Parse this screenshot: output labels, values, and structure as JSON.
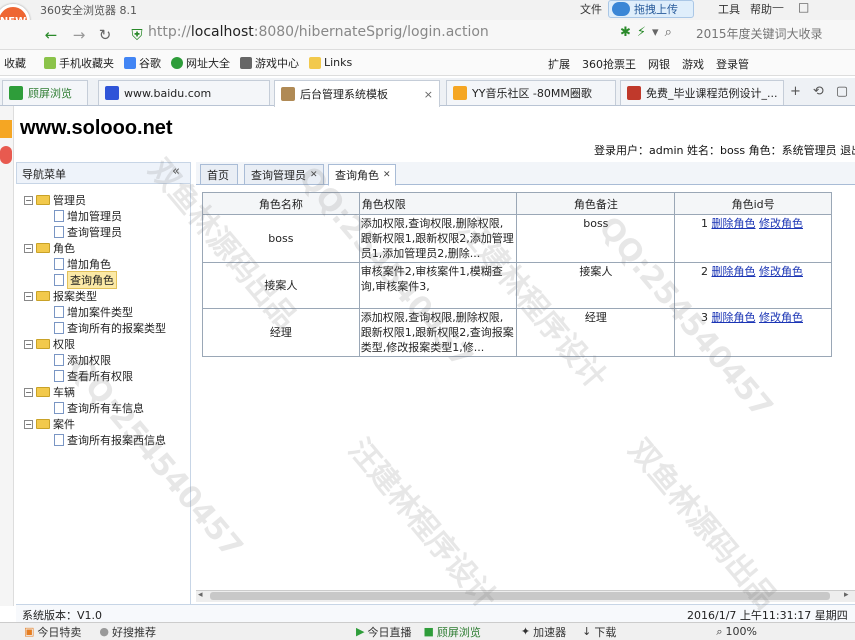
{
  "browser": {
    "logo_text": "NEW",
    "title": "360安全浏览器 8.1",
    "menus": [
      "文件",
      "工具",
      "帮助"
    ],
    "cloud_upload": "拖拽上传",
    "address_prefix": "http://",
    "address_host": "localhost",
    "address_rest": ":8080/hibernateSprig/login.action",
    "search_placeholder": "2015年度关键词大收录"
  },
  "bookmarks": {
    "items": [
      "收藏",
      "手机收藏夹",
      "谷歌",
      "网址大全",
      "游戏中心",
      "Links"
    ],
    "right": [
      "扩展",
      "360抢票王",
      "网银",
      "游戏",
      "登录管"
    ]
  },
  "tabs": [
    {
      "label": "顾屏浏览"
    },
    {
      "label": "www.baidu.com"
    },
    {
      "label": "后台管理系统模板"
    },
    {
      "label": "YY音乐社区 -80MM圈歌"
    },
    {
      "label": "免费_毕业课程范例设计_..."
    }
  ],
  "page": {
    "site_title": "www.solooo.net",
    "user_info": "登录用户：admin  姓名：boss  角色：系统管理员  退出"
  },
  "nav": {
    "header": "导航菜单",
    "collapse": "«",
    "groups": [
      {
        "label": "管理员",
        "items": [
          "增加管理员",
          "查询管理员"
        ]
      },
      {
        "label": "角色",
        "items": [
          "增加角色",
          "查询角色"
        ]
      },
      {
        "label": "报案类型",
        "items": [
          "增加案件类型",
          "查询所有的报案类型"
        ]
      },
      {
        "label": "权限",
        "items": [
          "添加权限",
          "查看所有权限"
        ]
      },
      {
        "label": "车辆",
        "items": [
          "查询所有车信息"
        ]
      },
      {
        "label": "案件",
        "items": [
          "查询所有报案西信息"
        ]
      }
    ]
  },
  "content_tabs": [
    "首页",
    "查询管理员",
    "查询角色"
  ],
  "table": {
    "headers": [
      "角色名称",
      "角色权限",
      "角色备注",
      "角色id号"
    ],
    "delete_label": "删除角色",
    "edit_label": "修改角色",
    "rows": [
      {
        "name": "boss",
        "perm": "添加权限,查询权限,删除权限, 跟新权限1,跟新权限2,添加管理员1,添加管理员2,删除...",
        "note": "boss",
        "id": "1"
      },
      {
        "name": "接案人",
        "perm": "审核案件2,审核案件1,模糊查询,审核案件3,",
        "note": "接案人",
        "id": "2"
      },
      {
        "name": "经理",
        "perm": "添加权限,查询权限,删除权限, 跟新权限1,跟新权限2,查询报案类型,修改报案类型1,修...",
        "note": "经理",
        "id": "3"
      }
    ]
  },
  "footer": {
    "version": "系统版本：V1.0",
    "clock": "2016/1/7 上午11:31:17 星期四"
  },
  "statusbar": {
    "items": [
      "今日特卖",
      "好搜推荐",
      "今日直播",
      "顾屏浏览",
      "加速器",
      "下载",
      "100%"
    ]
  },
  "watermark": {
    "qq": "QQ:254540457",
    "a": "汪建林程序设计",
    "b": "双鱼林源码出品"
  }
}
